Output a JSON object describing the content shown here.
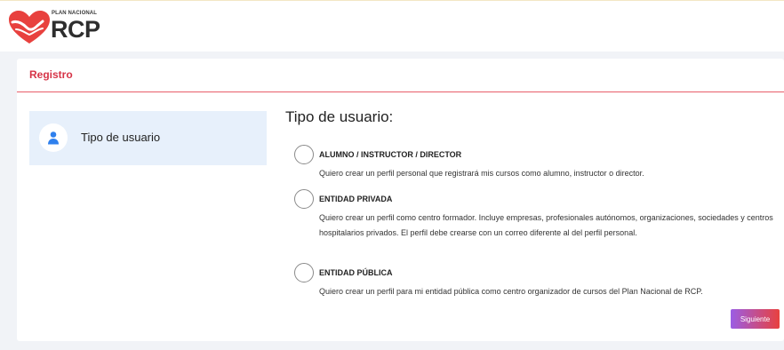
{
  "logo": {
    "small_text": "PLAN NACIONAL",
    "big_text": "RCP"
  },
  "card": {
    "title": "Registro"
  },
  "stepper": {
    "steps": [
      {
        "label": "Tipo de usuario",
        "icon": "user-icon"
      }
    ]
  },
  "content": {
    "title": "Tipo de usuario:",
    "options": [
      {
        "title": "ALUMNO / INSTRUCTOR / DIRECTOR",
        "description": "Quiero crear un perfil personal que registrará mis cursos como alumno, instructor o director."
      },
      {
        "title": "ENTIDAD PRIVADA",
        "description": "Quiero crear un perfil como centro formador. Incluye empresas, profesionales autónomos, organizaciones, sociedades y centros hospitalarios privados. El perfil debe crearse con un correo diferente al del perfil personal."
      },
      {
        "title": "ENTIDAD PÚBLICA",
        "description": "Quiero crear un perfil para mi entidad pública como centro organizador de cursos del Plan Nacional de RCP."
      }
    ],
    "next_label": "Siguiente"
  },
  "colors": {
    "accent": "#d63447",
    "step_bg": "#e7f0fb",
    "icon_blue": "#2f80ed"
  }
}
